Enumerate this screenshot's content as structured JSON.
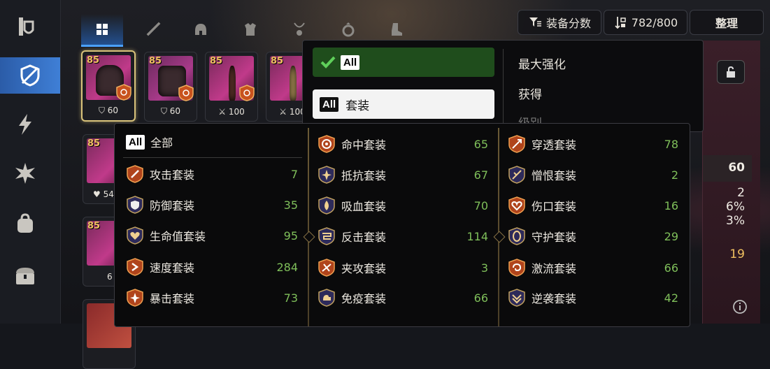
{
  "top_bar": {
    "gear_score_label": "装备分数",
    "inventory_count": "782/800",
    "organize_label": "整理"
  },
  "tabs": [
    "all-icon",
    "weapon-icon",
    "helmet-icon",
    "armor-icon",
    "necklace-icon",
    "ring-icon",
    "boots-icon"
  ],
  "left_rail": [
    "artifact-icon",
    "equipment-icon",
    "skill-icon",
    "material-icon",
    "bag-icon",
    "chest-icon"
  ],
  "items": [
    {
      "level": "85",
      "stat": "60",
      "stat_icon": "shield-icon"
    },
    {
      "level": "85",
      "stat": "60",
      "stat_icon": "shield-icon"
    },
    {
      "level": "85",
      "stat": "100",
      "stat_icon": "sword-icon"
    },
    {
      "level": "85",
      "stat": "100",
      "stat_icon": "sword-icon"
    }
  ],
  "left_column_items": [
    {
      "level": "85",
      "stat": "54",
      "stat_icon": "heart-icon"
    },
    {
      "level": "85",
      "stat": "6"
    }
  ],
  "sort_menu": {
    "all_label": "All",
    "set_chip": "All",
    "set_label": "套装",
    "options": [
      "最大强化",
      "获得",
      "级别"
    ]
  },
  "set_filter": {
    "all_chip": "All",
    "all_label": "全部",
    "columns": [
      [
        {
          "name": "攻击套装",
          "count": "7",
          "icon": "attack-set-icon"
        },
        {
          "name": "防御套装",
          "count": "35",
          "icon": "defense-set-icon"
        },
        {
          "name": "生命值套装",
          "count": "95",
          "icon": "health-set-icon"
        },
        {
          "name": "速度套装",
          "count": "284",
          "icon": "speed-set-icon"
        },
        {
          "name": "暴击套装",
          "count": "73",
          "icon": "critical-set-icon"
        }
      ],
      [
        {
          "name": "命中套装",
          "count": "65",
          "icon": "hit-set-icon"
        },
        {
          "name": "抵抗套装",
          "count": "67",
          "icon": "resist-set-icon"
        },
        {
          "name": "吸血套装",
          "count": "70",
          "icon": "lifesteal-set-icon"
        },
        {
          "name": "反击套装",
          "count": "114",
          "icon": "counter-set-icon"
        },
        {
          "name": "夹攻套装",
          "count": "3",
          "icon": "unity-set-icon"
        },
        {
          "name": "免疫套装",
          "count": "66",
          "icon": "immunity-set-icon"
        }
      ],
      [
        {
          "name": "穿透套装",
          "count": "78",
          "icon": "penetration-set-icon"
        },
        {
          "name": "憎恨套装",
          "count": "2",
          "icon": "rage-set-icon"
        },
        {
          "name": "伤口套装",
          "count": "16",
          "icon": "injury-set-icon"
        },
        {
          "name": "守护套装",
          "count": "29",
          "icon": "protection-set-icon"
        },
        {
          "name": "激流套装",
          "count": "66",
          "icon": "torrent-set-icon"
        },
        {
          "name": "逆袭套装",
          "count": "42",
          "icon": "revenge-set-icon"
        }
      ]
    ]
  },
  "right_panel": {
    "values": [
      "60",
      "2",
      "6%",
      "3%",
      "19"
    ]
  },
  "colors": {
    "accent_blue": "#3f7fd6",
    "count_green": "#7fbf5a",
    "level_gold": "#f0c060",
    "selected_green": "#1f4d1c"
  }
}
